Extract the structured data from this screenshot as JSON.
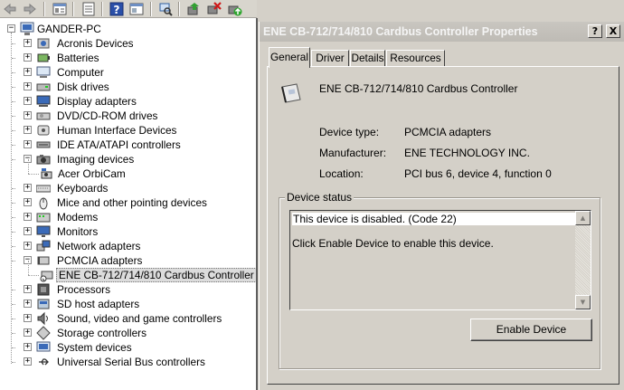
{
  "toolbar": {
    "buttons": [
      "back-icon",
      "forward-icon",
      "properties-icon",
      "update-icon",
      "help-icon",
      "view-icon",
      "scan-icon",
      "update-driver-icon",
      "uninstall-icon",
      "enable-icon"
    ]
  },
  "tree": {
    "root": "GANDER-PC",
    "items": [
      {
        "label": "Acronis Devices",
        "expander": "+"
      },
      {
        "label": "Batteries",
        "expander": "+"
      },
      {
        "label": "Computer",
        "expander": "+"
      },
      {
        "label": "Disk drives",
        "expander": "+"
      },
      {
        "label": "Display adapters",
        "expander": "+"
      },
      {
        "label": "DVD/CD-ROM drives",
        "expander": "+"
      },
      {
        "label": "Human Interface Devices",
        "expander": "+"
      },
      {
        "label": "IDE ATA/ATAPI controllers",
        "expander": "+"
      },
      {
        "label": "Imaging devices",
        "expander": "−"
      },
      {
        "label": "Acer OrbiCam",
        "child": true
      },
      {
        "label": "Keyboards",
        "expander": "+"
      },
      {
        "label": "Mice and other pointing devices",
        "expander": "+"
      },
      {
        "label": "Modems",
        "expander": "+"
      },
      {
        "label": "Monitors",
        "expander": "+"
      },
      {
        "label": "Network adapters",
        "expander": "+"
      },
      {
        "label": "PCMCIA adapters",
        "expander": "−"
      },
      {
        "label": "ENE CB-712/714/810 Cardbus Controller",
        "child": true,
        "selected": true
      },
      {
        "label": "Processors",
        "expander": "+"
      },
      {
        "label": "SD host adapters",
        "expander": "+"
      },
      {
        "label": "Sound, video and game controllers",
        "expander": "+"
      },
      {
        "label": "Storage controllers",
        "expander": "+"
      },
      {
        "label": "System devices",
        "expander": "+"
      },
      {
        "label": "Universal Serial Bus controllers",
        "expander": "+"
      }
    ]
  },
  "dialog": {
    "title": "ENE CB-712/714/810 Cardbus Controller Properties",
    "help_btn": "?",
    "close_btn": "X",
    "tabs": [
      "General",
      "Driver",
      "Details",
      "Resources"
    ],
    "active_tab": "General",
    "device_name": "ENE CB-712/714/810 Cardbus Controller",
    "props": [
      {
        "label": "Device type:",
        "value": "PCMCIA adapters"
      },
      {
        "label": "Manufacturer:",
        "value": "ENE TECHNOLOGY INC."
      },
      {
        "label": "Location:",
        "value": "PCI bus 6, device 4, function 0"
      }
    ],
    "status_legend": "Device status",
    "status_line1": "This device is disabled. (Code 22)",
    "status_line2": "Click Enable Device to enable this device.",
    "enable_button": "Enable Device"
  }
}
